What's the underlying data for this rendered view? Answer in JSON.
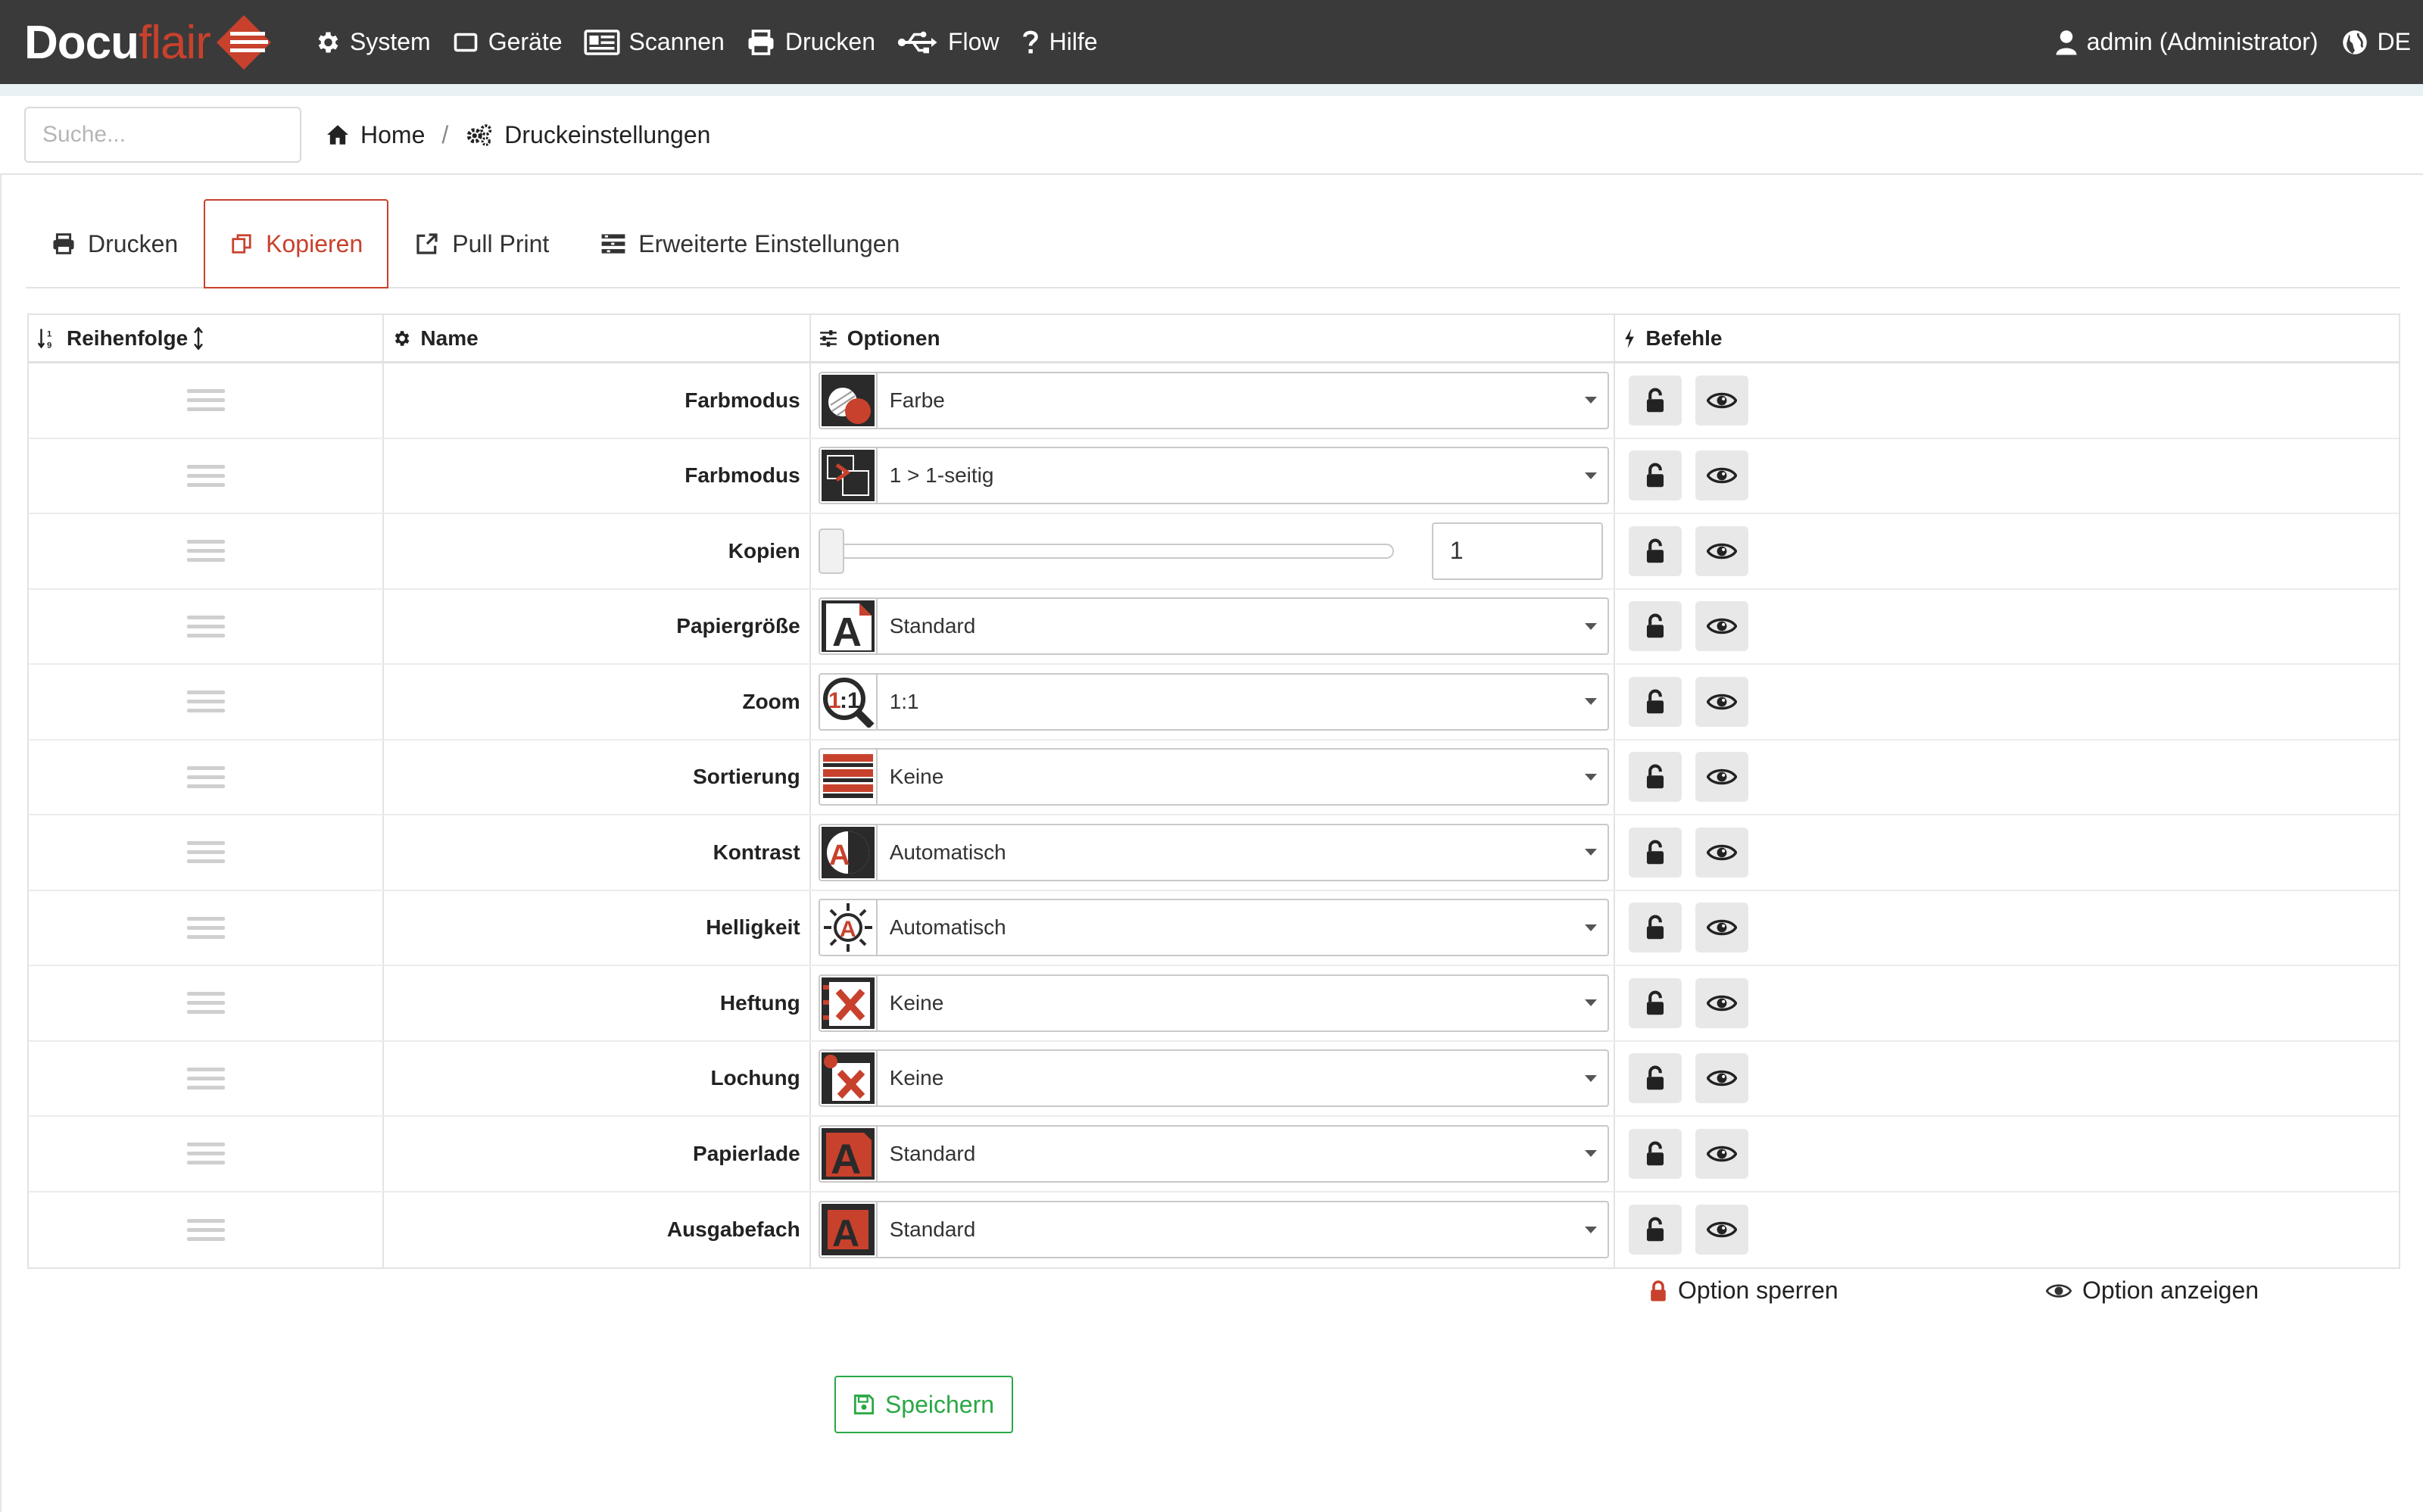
{
  "brand": {
    "part1": "Docu",
    "part2": "flair"
  },
  "nav": {
    "items": [
      {
        "label": "System",
        "icon": "gear-icon"
      },
      {
        "label": "Geräte",
        "icon": "device-icon"
      },
      {
        "label": "Scannen",
        "icon": "scanner-icon"
      },
      {
        "label": "Drucken",
        "icon": "printer-icon"
      },
      {
        "label": "Flow",
        "icon": "usb-flow-icon"
      },
      {
        "label": "Hilfe",
        "icon": "question-icon"
      }
    ],
    "user": "admin (Administrator)",
    "language": "DE"
  },
  "search": {
    "placeholder": "Suche..."
  },
  "breadcrumb": {
    "home": "Home",
    "separator": "/",
    "current": "Druckeinstellungen"
  },
  "tabs": [
    {
      "label": "Drucken",
      "active": false
    },
    {
      "label": "Kopieren",
      "active": true
    },
    {
      "label": "Pull Print",
      "active": false
    },
    {
      "label": "Erweiterte Einstellungen",
      "active": false
    }
  ],
  "table": {
    "headers": {
      "order": "Reihenfolge",
      "name": "Name",
      "options": "Optionen",
      "commands": "Befehle"
    },
    "rows": [
      {
        "name": "Farbmodus",
        "value": "Farbe",
        "icon": "color-mode-icon"
      },
      {
        "name": "Farbmodus",
        "value": "1 > 1-seitig",
        "icon": "duplex-icon"
      },
      {
        "name": "Kopien",
        "value": "1",
        "type": "slider",
        "slider_fraction": 0
      },
      {
        "name": "Papiergröße",
        "value": "Standard",
        "icon": "paper-size-icon"
      },
      {
        "name": "Zoom",
        "value": "1:1",
        "icon": "zoom-icon"
      },
      {
        "name": "Sortierung",
        "value": "Keine",
        "icon": "sort-icon"
      },
      {
        "name": "Kontrast",
        "value": "Automatisch",
        "icon": "contrast-icon"
      },
      {
        "name": "Helligkeit",
        "value": "Automatisch",
        "icon": "brightness-icon"
      },
      {
        "name": "Heftung",
        "value": "Keine",
        "icon": "staple-icon"
      },
      {
        "name": "Lochung",
        "value": "Keine",
        "icon": "punch-icon"
      },
      {
        "name": "Papierlade",
        "value": "Standard",
        "icon": "paper-tray-icon"
      },
      {
        "name": "Ausgabefach",
        "value": "Standard",
        "icon": "output-tray-icon"
      }
    ]
  },
  "legend": {
    "lock": "Option sperren",
    "show": "Option anzeigen"
  },
  "save_label": "Speichern",
  "colors": {
    "navbar": "#3a3a3a",
    "accent": "#c8412c",
    "success": "#2aa845"
  }
}
